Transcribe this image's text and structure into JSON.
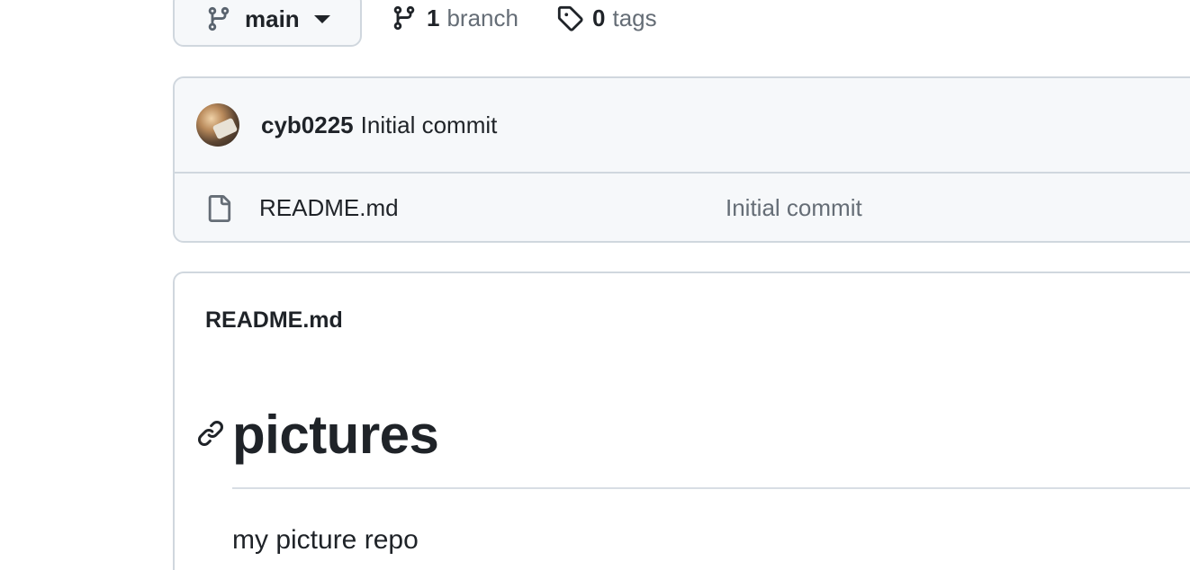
{
  "branch_bar": {
    "current_branch": "main",
    "branch_count": "1",
    "branch_word": "branch",
    "tag_count": "0",
    "tag_word": "tags",
    "icons": {
      "branch": "git-branch-icon",
      "tag": "tag-icon",
      "dropdown": "caret-down-icon"
    }
  },
  "latest_commit": {
    "author": "cyb0225",
    "message": "Initial commit"
  },
  "files": [
    {
      "name": "README.md",
      "last_commit": "Initial commit",
      "icon": "file-icon"
    }
  ],
  "readme": {
    "file_name": "README.md",
    "heading": "pictures",
    "body": "my picture repo"
  },
  "colors": {
    "text": "#1f2328",
    "muted": "#656d76",
    "border": "#d0d7de",
    "header_bg": "#f6f8fa"
  }
}
